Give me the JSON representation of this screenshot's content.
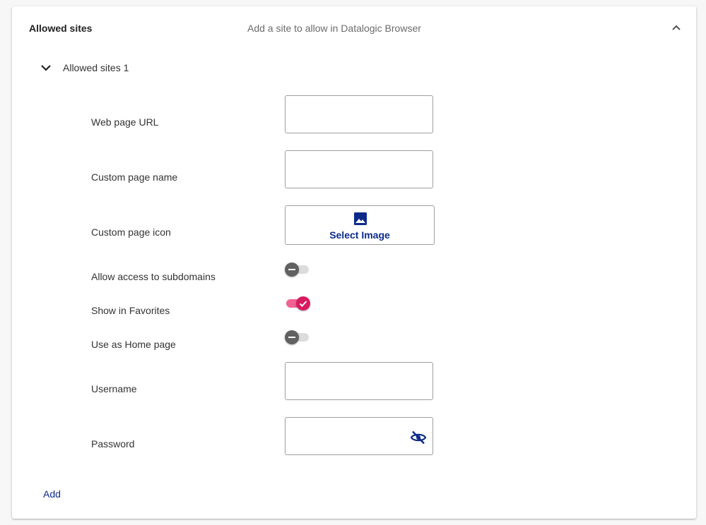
{
  "section": {
    "title": "Allowed sites",
    "description": "Add a site to allow in Datalogic Browser",
    "collapse_icon": "chevron-up-icon"
  },
  "item": {
    "title": "Allowed sites 1",
    "toggle_icon": "chevron-down-icon"
  },
  "fields": {
    "web_page_url": {
      "label": "Web page URL",
      "value": ""
    },
    "custom_page_name": {
      "label": "Custom page name",
      "value": ""
    },
    "custom_page_icon": {
      "label": "Custom page icon",
      "button_label": "Select Image",
      "icon": "image-icon"
    },
    "allow_subdomains": {
      "label": "Allow access to subdomains",
      "checked": false
    },
    "show_in_favorites": {
      "label": "Show in Favorites",
      "checked": true
    },
    "use_as_home": {
      "label": "Use as Home page",
      "checked": false
    },
    "username": {
      "label": "Username",
      "value": ""
    },
    "password": {
      "label": "Password",
      "value": "",
      "visibility_icon": "eye-off-icon"
    }
  },
  "actions": {
    "add_label": "Add"
  },
  "colors": {
    "accent": "#0d2a8a",
    "toggle_on": "#d81b60",
    "toggle_on_track": "#f06292",
    "toggle_off": "#616161"
  }
}
